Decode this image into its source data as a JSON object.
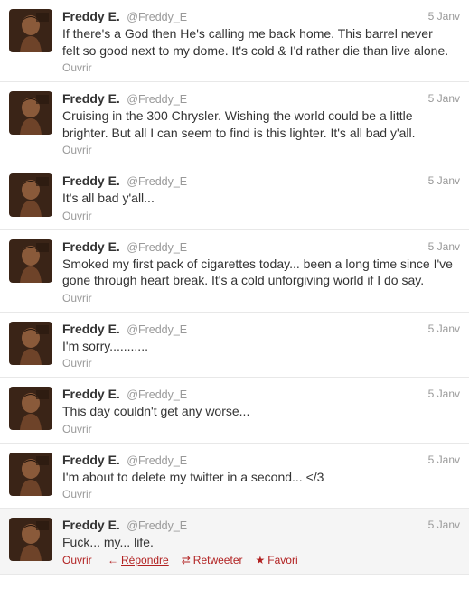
{
  "tweets": [
    {
      "fullname": "Freddy E.",
      "username": "@Freddy_E",
      "time": "5 Janv",
      "lines": [
        "If there's a God then He's calling me back home. This barrel never",
        "felt so good next to my dome. It's cold & I'd rather die than live alone."
      ],
      "open_label": "Ouvrir"
    },
    {
      "fullname": "Freddy E.",
      "username": "@Freddy_E",
      "time": "5 Janv",
      "lines": [
        "Cruising in the 300 Chrysler. Wishing the world could be a little",
        "brighter. But all I can seem to find is this lighter. It's all bad y'all."
      ],
      "open_label": "Ouvrir"
    },
    {
      "fullname": "Freddy E.",
      "username": "@Freddy_E",
      "time": "5 Janv",
      "lines": [
        "It's all bad y'all..."
      ],
      "open_label": "Ouvrir"
    },
    {
      "fullname": "Freddy E.",
      "username": "@Freddy_E",
      "time": "5 Janv",
      "lines": [
        "Smoked my first pack of cigarettes today... been a long time since I've",
        "gone through heart break. It's a cold unforgiving world if I do say."
      ],
      "open_label": "Ouvrir"
    },
    {
      "fullname": "Freddy E.",
      "username": "@Freddy_E",
      "time": "5 Janv",
      "lines": [
        "I'm sorry..........."
      ],
      "open_label": "Ouvrir"
    },
    {
      "fullname": "Freddy E.",
      "username": "@Freddy_E",
      "time": "5 Janv",
      "lines": [
        "This day couldn't get any worse..."
      ],
      "open_label": "Ouvrir"
    },
    {
      "fullname": "Freddy E.",
      "username": "@Freddy_E",
      "time": "5 Janv",
      "lines": [
        "I'm about to delete my twitter in a second... </3"
      ],
      "open_label": "Ouvrir"
    },
    {
      "fullname": "Freddy E.",
      "username": "@Freddy_E",
      "time": "5 Janv",
      "lines": [
        "Fuck... my... life."
      ],
      "open_label": "Ouvrir",
      "hover": true,
      "actions": {
        "reply": "Répondre",
        "reply_icon": "reply-arrow-icon",
        "retweet": "Retweeter",
        "retweet_icon": "retweet-icon",
        "favorite": "Favori",
        "favorite_icon": "star-icon"
      }
    }
  ],
  "colors": {
    "link_hover": "#b22222",
    "meta": "#999999",
    "text": "#333333",
    "hover_bg": "#f5f5f5"
  }
}
